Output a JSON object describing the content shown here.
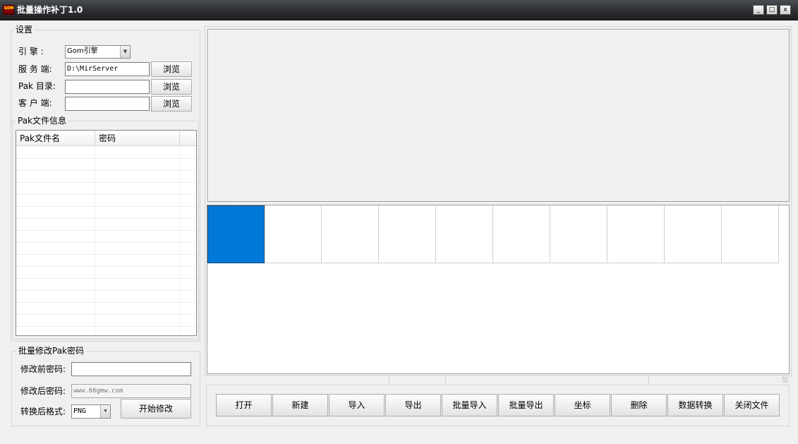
{
  "window": {
    "title": "批量操作补丁1.0",
    "icon": "app-logo-icon",
    "icon_text": "GOM",
    "controls": {
      "minimize": "_",
      "maximize": "□",
      "close": "x"
    }
  },
  "settings": {
    "group_label": "设置",
    "engine_label": "引  擎  :",
    "engine_value": "Gom引擎",
    "server_label": "服 务 端:",
    "server_value": "D:\\MirServer",
    "pak_dir_label": "Pak 目录:",
    "pak_dir_value": "",
    "client_label": "客 户 端:",
    "client_value": "",
    "browse_label": "浏览",
    "combo_arrow": "▼"
  },
  "pak_info": {
    "group_label": "Pak文件信息",
    "columns": [
      "Pak文件名",
      "密码"
    ],
    "rows": []
  },
  "batch_password": {
    "group_label": "批量修改Pak密码",
    "old_password_label": "修改前密码:",
    "old_password_value": "",
    "new_password_label": "修改后密码:",
    "new_password_placeholder": "www.66gmw.com",
    "format_label": "转换后格式:",
    "format_value": "PNG",
    "start_button": "开始修改"
  },
  "toolbar": {
    "buttons": [
      "打开",
      "新建",
      "导入",
      "导出",
      "批量导入",
      "批量导出",
      "坐标",
      "删除",
      "数据转换",
      "关闭文件"
    ]
  },
  "image_grid": {
    "cell_count": 10,
    "selected_index": 0,
    "selected_color": "#0078d7"
  }
}
